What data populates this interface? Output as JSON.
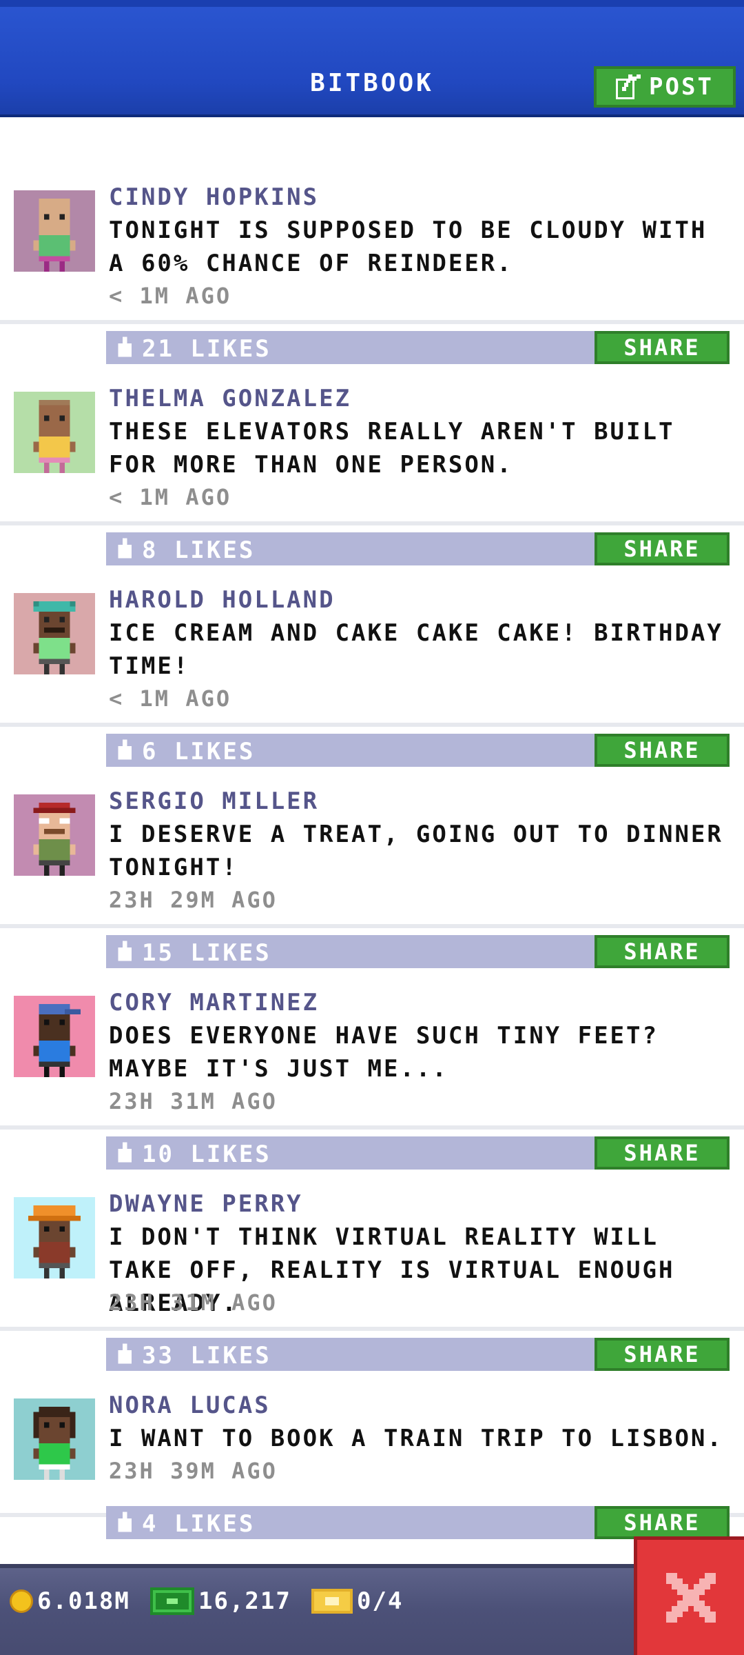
{
  "header": {
    "title": "BITBOOK",
    "post_label": "POST"
  },
  "feed": {
    "share_label": "SHARE",
    "posts": [
      {
        "name": "CINDY HOPKINS",
        "text": "TONIGHT IS SUPPOSED TO BE CLOUDY WITH A 60% CHANCE OF REINDEER.",
        "time": "< 1M AGO",
        "likes": "21 LIKES",
        "avatar_bg": "#b288a8"
      },
      {
        "name": "THELMA GONZALEZ",
        "text": "THESE ELEVATORS REALLY AREN'T BUILT FOR MORE THAN ONE PERSON.",
        "time": "< 1M AGO",
        "likes": "8 LIKES",
        "avatar_bg": "#b5dea8"
      },
      {
        "name": "HAROLD HOLLAND",
        "text": "ICE CREAM AND CAKE CAKE CAKE! BIRTHDAY TIME!",
        "time": "< 1M AGO",
        "likes": "6 LIKES",
        "avatar_bg": "#d9a8aa"
      },
      {
        "name": "SERGIO MILLER",
        "text": "I DESERVE A TREAT, GOING OUT TO DINNER TONIGHT!",
        "time": "23H 29M AGO",
        "likes": "15 LIKES",
        "avatar_bg": "#c28bb1"
      },
      {
        "name": "CORY MARTINEZ",
        "text": "DOES EVERYONE HAVE SUCH TINY FEET? MAYBE IT'S JUST ME...",
        "time": "23H 31M AGO",
        "likes": "10 LIKES",
        "avatar_bg": "#f08bac"
      },
      {
        "name": "DWAYNE PERRY",
        "text": "I DON'T THINK VIRTUAL REALITY WILL TAKE OFF, REALITY IS VIRTUAL ENOUGH ALREADY.",
        "time": "23H 31M AGO",
        "likes": "33 LIKES",
        "avatar_bg": "#bff1fa"
      },
      {
        "name": "NORA LUCAS",
        "text": "I WANT TO BOOK A TRAIN TRIP TO LISBON.",
        "time": "23H 39M AGO",
        "likes": "4 LIKES",
        "avatar_bg": "#8ecfd0"
      }
    ]
  },
  "bottom_bar": {
    "coins": "6.018M",
    "bux": "16,217",
    "tickets": "0/4"
  },
  "icons": {
    "post": "edit-icon",
    "like": "thumbs-up-icon",
    "coin": "coin-icon",
    "bux": "bux-icon",
    "ticket": "ticket-icon",
    "close": "close-icon"
  },
  "colors": {
    "header_blue": "#2148c0",
    "button_green": "#3fa63a",
    "likes_bar": "#b3b6d8",
    "name_purple": "#55558a",
    "close_red": "#e2373a"
  }
}
